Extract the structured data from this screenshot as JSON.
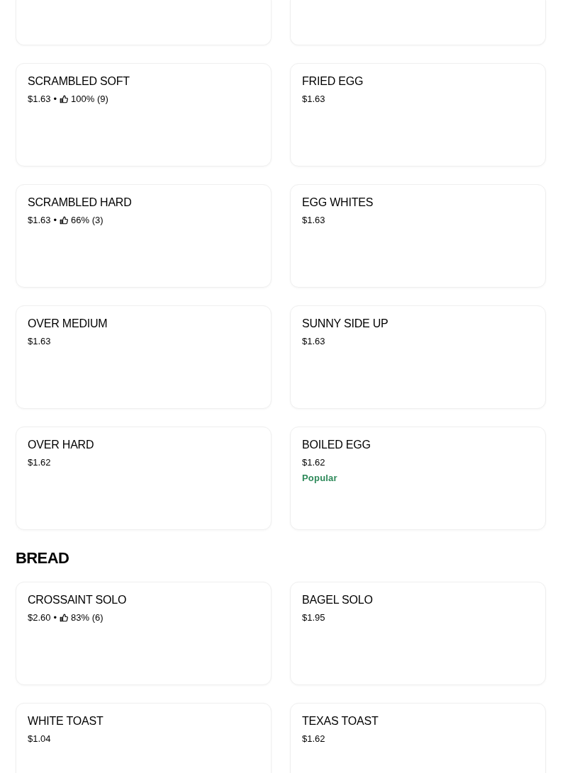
{
  "sections": [
    {
      "items": [
        {
          "kind": "clipped"
        },
        {
          "kind": "clipped"
        },
        {
          "kind": "dish",
          "name": "SCRAMBLED SOFT",
          "price": "$1.63",
          "rating": {
            "separator": "•",
            "text": "100% (9)"
          }
        },
        {
          "kind": "dish",
          "name": "FRIED EGG",
          "price": "$1.63"
        },
        {
          "kind": "dish",
          "name": "SCRAMBLED HARD",
          "price": "$1.63",
          "rating": {
            "separator": "•",
            "text": "66% (3)"
          }
        },
        {
          "kind": "dish",
          "name": "EGG WHITES",
          "price": "$1.63"
        },
        {
          "kind": "dish",
          "name": "OVER MEDIUM",
          "price": "$1.63"
        },
        {
          "kind": "dish",
          "name": "SUNNY SIDE UP",
          "price": "$1.63"
        },
        {
          "kind": "dish",
          "name": "OVER HARD",
          "price": "$1.62"
        },
        {
          "kind": "dish",
          "name": "BOILED EGG",
          "price": "$1.62",
          "badge": "Popular"
        }
      ]
    },
    {
      "title": "BREAD",
      "items": [
        {
          "kind": "dish",
          "name": "CROSSAINT SOLO",
          "price": "$2.60",
          "rating": {
            "separator": "•",
            "text": "83% (6)"
          }
        },
        {
          "kind": "dish",
          "name": "BAGEL SOLO",
          "price": "$1.95"
        },
        {
          "kind": "dish",
          "name": "WHITE TOAST",
          "price": "$1.04"
        },
        {
          "kind": "dish",
          "name": "TEXAS TOAST",
          "price": "$1.62"
        }
      ]
    }
  ]
}
